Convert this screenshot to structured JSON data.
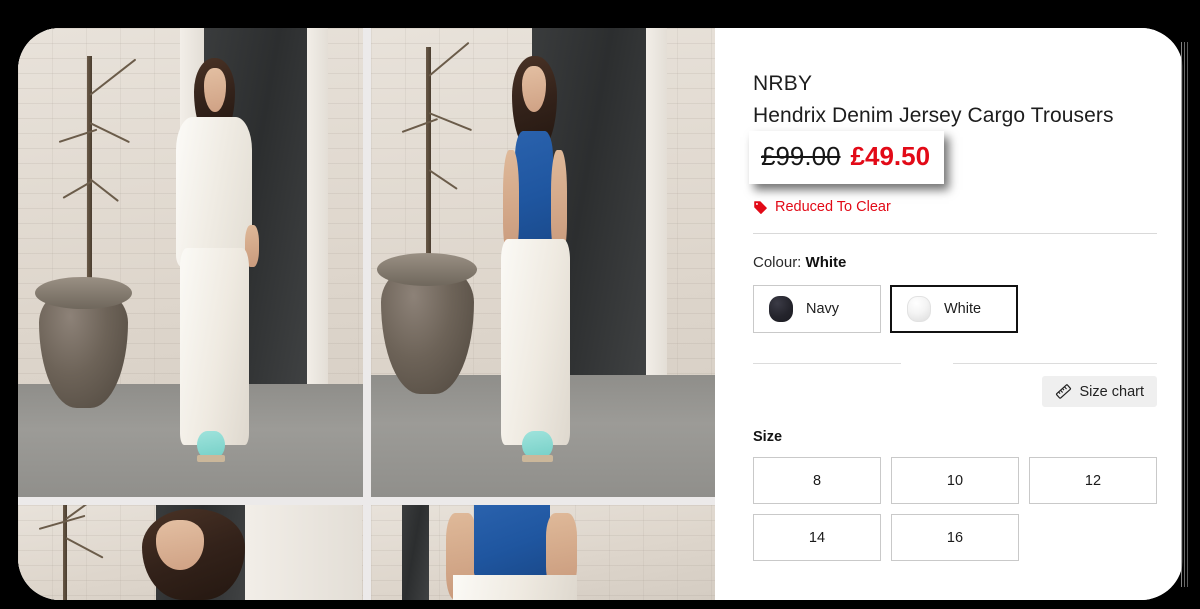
{
  "theme": {
    "backdrop": "#000000",
    "card_bg": "#ffffff",
    "gallery_bg": "#eceaea",
    "accent_red": "#e20a17",
    "selected_border": "#111111",
    "swatch_border": "#c9c9c9"
  },
  "product": {
    "brand": "NRBY",
    "title": "Hendrix Denim Jersey Cargo Trousers",
    "price_old": "£99.00",
    "price_new": "£49.50",
    "promo_label": "Reduced To Clear",
    "promo_icon": "price-tag-icon"
  },
  "colour": {
    "label_prefix": "Colour:",
    "selected": "White",
    "options": [
      {
        "name": "Navy",
        "hex": "#24242c",
        "selected": false
      },
      {
        "name": "White",
        "hex": "#f4f4f4",
        "selected": true
      }
    ]
  },
  "size": {
    "chart_button": "Size chart",
    "chart_icon": "ruler-icon",
    "label": "Size",
    "options": [
      "8",
      "10",
      "12",
      "14",
      "16"
    ]
  },
  "gallery": {
    "images": [
      {
        "alt": "Model walking in white cargo trousers, blue tank and white shirt"
      },
      {
        "alt": "Model standing hands in pockets, white cargo trousers"
      },
      {
        "alt": "Close-up portrait of model beside potted tree"
      },
      {
        "alt": "Close-up of blue tank top and white trousers waist"
      }
    ]
  }
}
